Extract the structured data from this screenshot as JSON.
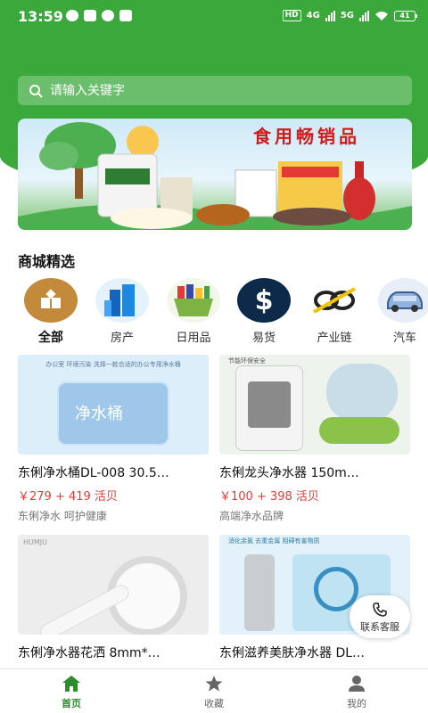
{
  "status_bar": {
    "time": "13:59",
    "network": "4G",
    "network2": "5G",
    "hd": "HD",
    "battery": "41"
  },
  "search": {
    "placeholder": "请输入关键字"
  },
  "banner": {
    "title": "食用畅销品"
  },
  "section": {
    "title": "商城精选"
  },
  "categories": [
    {
      "label": "全部",
      "icon": "grid-icon",
      "active": true
    },
    {
      "label": "房产",
      "icon": "building-icon",
      "active": false
    },
    {
      "label": "日用品",
      "icon": "basket-icon",
      "active": false
    },
    {
      "label": "易货",
      "icon": "dollar-icon",
      "active": false
    },
    {
      "label": "产业链",
      "icon": "chain-icon",
      "active": false
    },
    {
      "label": "汽车",
      "icon": "car-icon",
      "active": false
    }
  ],
  "products": [
    {
      "name": "东俐净水桶DL-008 30.5…",
      "price": "￥279 + 419 活贝",
      "sub": "东俐净水 呵护健康",
      "image_text": "净水桶",
      "image_caption": "办公室 环境污染 洗择一款合适的办公专用净水桶"
    },
    {
      "name": "东俐龙头净水器 150m…",
      "price": "￥100 + 398 活贝",
      "sub": "高端净水品牌",
      "image_caption": "节能环保安全"
    },
    {
      "name": "东俐净水器花洒 8mm*…",
      "price": "",
      "sub": "",
      "image_caption": "HUMJU"
    },
    {
      "name": "东俐滋养美肤净水器 DL…",
      "price": "",
      "sub": "",
      "image_caption": "消化余氯 去重金属 阻碍有害物质"
    }
  ],
  "support": {
    "label": "联系客服"
  },
  "nav": [
    {
      "label": "首页",
      "icon": "home-icon",
      "active": true
    },
    {
      "label": "收藏",
      "icon": "star-icon",
      "active": false
    },
    {
      "label": "我的",
      "icon": "user-icon",
      "active": false
    }
  ],
  "colors": {
    "brand_green": "#3aa83a",
    "price_red": "#e53935"
  }
}
